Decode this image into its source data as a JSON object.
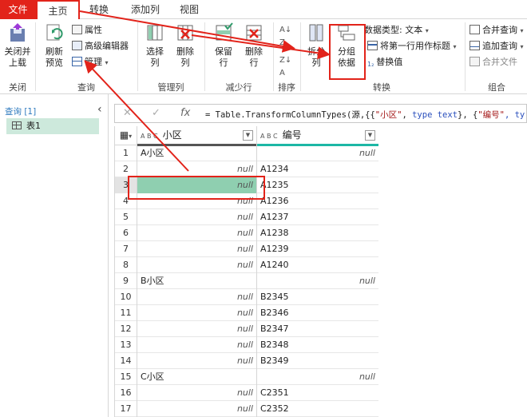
{
  "menu_tabs": [
    "文件",
    "主页",
    "转换",
    "添加列",
    "视图"
  ],
  "ribbon": {
    "close_load": "关闭并\n上载",
    "close_load_dd": "▾",
    "refresh": "刷新\n预览",
    "properties": "属性",
    "advanced_editor": "高级编辑器",
    "manage": "管理",
    "choose_cols": "选择\n列",
    "remove_cols": "删除\n列",
    "keep_rows": "保留\n行",
    "remove_rows": "删除\n行",
    "split_col": "拆分\n列",
    "group_by": "分组\n依据",
    "data_type": "数据类型: 文本",
    "first_row_header": "将第一行用作标题",
    "replace_values": "替换值",
    "merge_queries": "合并查询",
    "append_queries": "追加查询",
    "combine_files": "合并文件",
    "groups": {
      "close": "关闭",
      "query": "查询",
      "manage_cols": "管理列",
      "reduce_rows": "减少行",
      "sort": "排序",
      "transform": "转换",
      "combine": "组合"
    }
  },
  "query_pane": {
    "header": "查询 [1]",
    "item": "表1"
  },
  "formula": {
    "fx": "fx",
    "prefix": "= Table.TransformColumnTypes(源,{{",
    "s1": "\"小区\"",
    "mid1": ", ",
    "kw1": "type text",
    "mid2": "}, {",
    "s2": "\"编号\"",
    "mid3": ", ty"
  },
  "grid": {
    "col1": "小区",
    "col2": "编号",
    "abc": "A B C",
    "rows": [
      {
        "n": "1",
        "c1": "A小区",
        "c2": "null"
      },
      {
        "n": "2",
        "c1": "null",
        "c2": "A1234"
      },
      {
        "n": "3",
        "c1": "null",
        "c2": "A1235"
      },
      {
        "n": "4",
        "c1": "null",
        "c2": "A1236"
      },
      {
        "n": "5",
        "c1": "null",
        "c2": "A1237"
      },
      {
        "n": "6",
        "c1": "null",
        "c2": "A1238"
      },
      {
        "n": "7",
        "c1": "null",
        "c2": "A1239"
      },
      {
        "n": "8",
        "c1": "null",
        "c2": "A1240"
      },
      {
        "n": "9",
        "c1": "B小区",
        "c2": "null"
      },
      {
        "n": "10",
        "c1": "null",
        "c2": "B2345"
      },
      {
        "n": "11",
        "c1": "null",
        "c2": "B2346"
      },
      {
        "n": "12",
        "c1": "null",
        "c2": "B2347"
      },
      {
        "n": "13",
        "c1": "null",
        "c2": "B2348"
      },
      {
        "n": "14",
        "c1": "null",
        "c2": "B2349"
      },
      {
        "n": "15",
        "c1": "C小区",
        "c2": "null"
      },
      {
        "n": "16",
        "c1": "null",
        "c2": "C2351"
      },
      {
        "n": "17",
        "c1": "null",
        "c2": "C2352"
      }
    ],
    "selected_row": "3"
  },
  "colors": {
    "accent_red": "#e2231a",
    "selection_green": "#8fcfb0",
    "teal": "#1db7a5"
  }
}
